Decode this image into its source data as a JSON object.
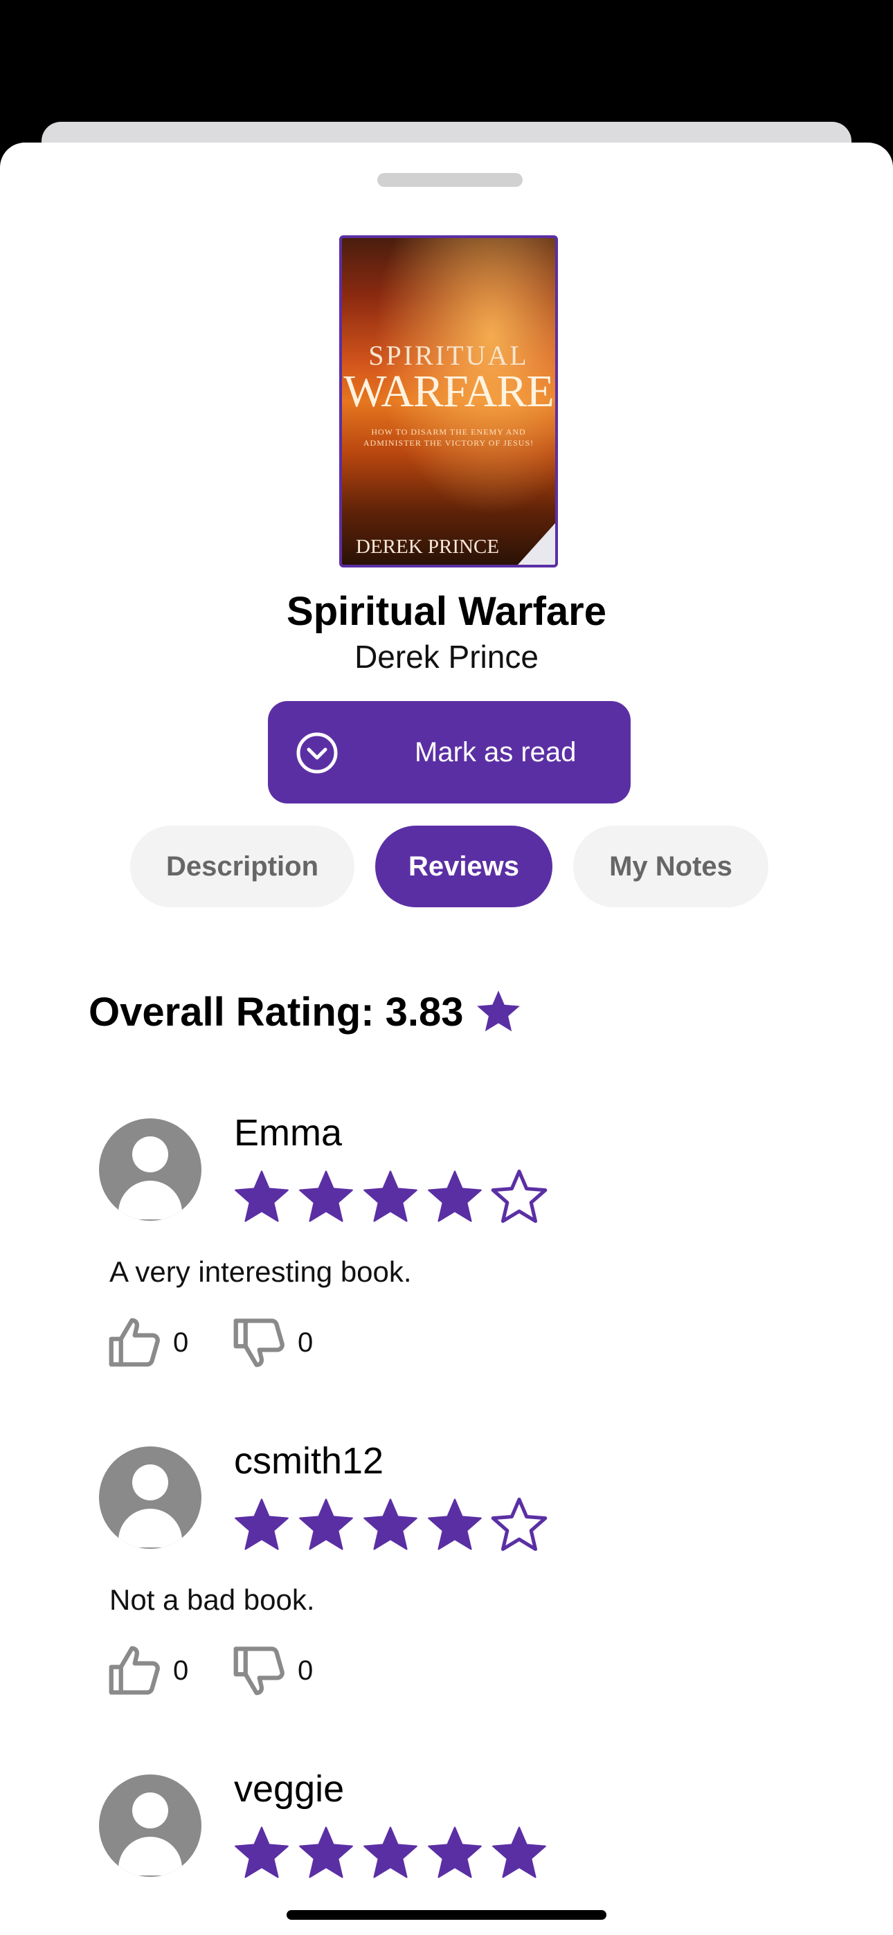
{
  "book": {
    "cover_title_line1": "SPIRITUAL",
    "cover_title_line2": "WARFARE",
    "cover_subtitle": "How to Disarm the Enemy and Administer the Victory of Jesus!",
    "cover_author": "DEREK PRINCE",
    "title": "Spiritual Warfare",
    "author": "Derek Prince"
  },
  "actions": {
    "mark_as_read": "Mark as read"
  },
  "tabs": [
    {
      "label": "Description",
      "active": false
    },
    {
      "label": "Reviews",
      "active": true
    },
    {
      "label": "My Notes",
      "active": false
    }
  ],
  "overall": {
    "label": "Overall Rating: 3.83",
    "value": 3.83
  },
  "reviews": [
    {
      "user": "Emma",
      "rating": 4,
      "text": "A very interesting book.",
      "likes": "0",
      "dislikes": "0"
    },
    {
      "user": "csmith12",
      "rating": 4,
      "text": "Not a bad book.",
      "likes": "0",
      "dislikes": "0"
    },
    {
      "user": "veggie",
      "rating": 5,
      "text": "",
      "likes": "",
      "dislikes": ""
    }
  ],
  "colors": {
    "accent": "#5b2fa4",
    "tab_inactive_bg": "#f3f3f3",
    "icon_gray": "#8a8a8a"
  },
  "icons": {
    "mark_read": "chevron-circle-icon",
    "star": "star-icon",
    "avatar": "person-icon",
    "like": "thumbs-up-icon",
    "dislike": "thumbs-down-icon"
  }
}
